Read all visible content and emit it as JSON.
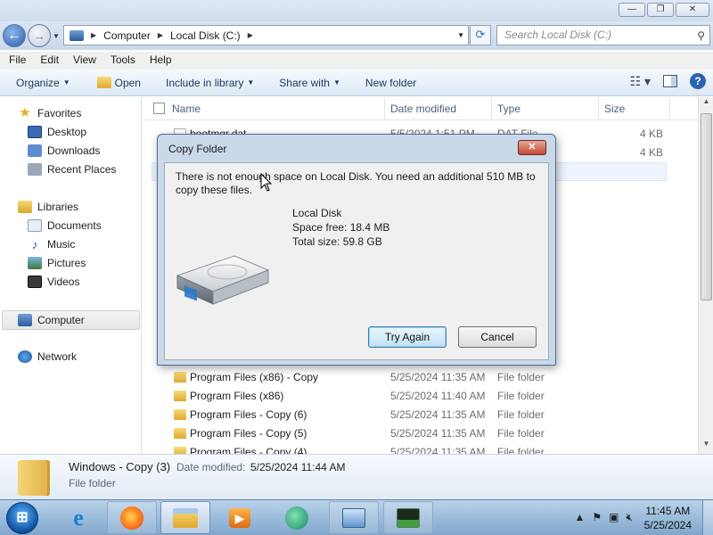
{
  "window": {
    "minimize_label": "—",
    "maximize_label": "❐",
    "close_label": "✕"
  },
  "address": {
    "crumbs": [
      "Computer",
      "Local Disk (C:)"
    ],
    "search_placeholder": "Search Local Disk (C:)"
  },
  "menu": [
    "File",
    "Edit",
    "View",
    "Tools",
    "Help"
  ],
  "toolbar": {
    "organize": "Organize",
    "open": "Open",
    "include_in_library": "Include in library",
    "share_with": "Share with",
    "new_folder": "New folder"
  },
  "nav": {
    "favorites": "Favorites",
    "desktop": "Desktop",
    "downloads": "Downloads",
    "recent_places": "Recent Places",
    "libraries": "Libraries",
    "documents": "Documents",
    "music": "Music",
    "pictures": "Pictures",
    "videos": "Videos",
    "computer": "Computer",
    "network": "Network"
  },
  "columns": {
    "name": "Name",
    "date_modified": "Date modified",
    "type": "Type",
    "size": "Size"
  },
  "files_top": [
    {
      "name": "bootmgr.dat",
      "date": "5/5/2024 1:51 PM",
      "type": "DAT File",
      "size": "4 KB"
    },
    {
      "name": "",
      "date": "",
      "type": "",
      "size": "4 KB"
    }
  ],
  "files": [
    {
      "name": "Program Files (x86) - Copy",
      "date": "5/25/2024 11:35 AM",
      "type": "File folder",
      "size": ""
    },
    {
      "name": "Program Files (x86)",
      "date": "5/25/2024 11:40 AM",
      "type": "File folder",
      "size": ""
    },
    {
      "name": "Program Files - Copy (6)",
      "date": "5/25/2024 11:35 AM",
      "type": "File folder",
      "size": ""
    },
    {
      "name": "Program Files - Copy (5)",
      "date": "5/25/2024 11:35 AM",
      "type": "File folder",
      "size": ""
    },
    {
      "name": "Program Files - Copy (4)",
      "date": "5/25/2024 11:35 AM",
      "type": "File folder",
      "size": ""
    }
  ],
  "details": {
    "name": "Windows - Copy (3)",
    "date_label": "Date modified:",
    "date_value": "5/25/2024 11:44 AM",
    "type": "File folder"
  },
  "dialog": {
    "title": "Copy Folder",
    "close_label": "✕",
    "message": "There is not enough space on Local Disk. You need an additional 510 MB to copy these files.",
    "disk_name": "Local Disk",
    "space_free": "Space free: 18.4 MB",
    "total_size": "Total size: 59.8 GB",
    "try_again_label": "Try Again",
    "cancel_label": "Cancel"
  },
  "taskbar": {
    "time": "11:45 AM",
    "date": "5/25/2024"
  },
  "colors": {
    "accent": "#2a64b0",
    "dialog_frame": "#c9d9ea",
    "taskbar": "#7fa6cc"
  }
}
